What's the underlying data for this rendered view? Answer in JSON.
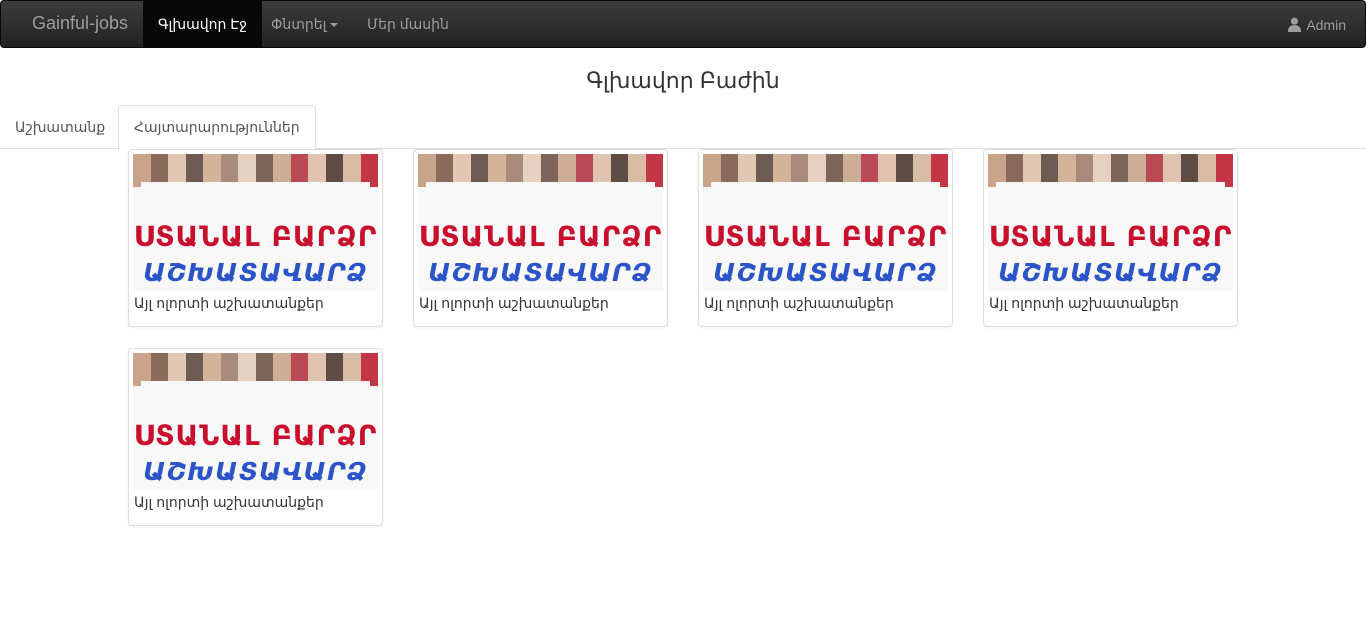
{
  "navbar": {
    "brand": "Gainful-jobs",
    "items": [
      {
        "label": "Գլխավոր Էջ",
        "active": true
      },
      {
        "label": "Փնտրել",
        "dropdown": true
      },
      {
        "label": "Մեր մասին"
      }
    ],
    "user": {
      "icon": "user-icon",
      "label": "Admin"
    }
  },
  "page": {
    "title": "Գլխավոր Բաժին"
  },
  "tabs": [
    {
      "label": "Աշխատանք",
      "active": false
    },
    {
      "label": "Հայտարարություններ",
      "active": true
    }
  ],
  "cards": [
    {
      "image": {
        "line1": "ՍՏԱՆԱԼ ԲԱՐՁՐ",
        "line2": "ԱՇԽԱՏԱՎԱՐՁ"
      },
      "caption": "Այլ ոլորտի աշխատանքեր"
    },
    {
      "image": {
        "line1": "ՍՏԱՆԱԼ ԲԱՐՁՐ",
        "line2": "ԱՇԽԱՏԱՎԱՐՁ"
      },
      "caption": "Այլ ոլորտի աշխատանքեր"
    },
    {
      "image": {
        "line1": "ՍՏԱՆԱԼ ԲԱՐՁՐ",
        "line2": "ԱՇԽԱՏԱՎԱՐՁ"
      },
      "caption": "Այլ ոլորտի աշխատանքեր"
    },
    {
      "image": {
        "line1": "ՍՏԱՆԱԼ ԲԱՐՁՐ",
        "line2": "ԱՇԽԱՏԱՎԱՐՁ"
      },
      "caption": "Այլ ոլորտի աշխատանքեր"
    },
    {
      "image": {
        "line1": "ՍՏԱՆԱԼ ԲԱՐՁՐ",
        "line2": "ԱՇԽԱՏԱՎԱՐՁ"
      },
      "caption": "Այլ ոլորտի աշխատանքեր"
    }
  ],
  "colors": {
    "navbar_bg": "#222222",
    "navbar_text": "#9d9d9d",
    "image_headline_red": "#c8102e",
    "image_headline_blue": "#2c54c9"
  }
}
